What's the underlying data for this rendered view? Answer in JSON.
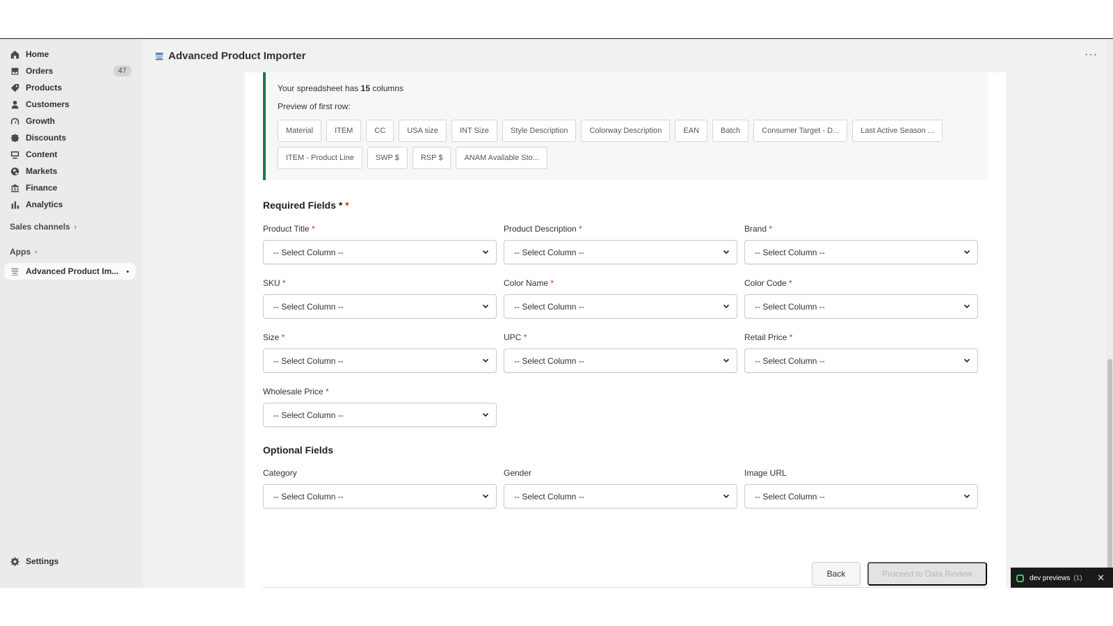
{
  "app": {
    "title": "Advanced Product Importer",
    "more": "···"
  },
  "sidebar": {
    "items": [
      {
        "label": "Home",
        "icon": "home-icon"
      },
      {
        "label": "Orders",
        "icon": "inbox-icon",
        "badge": "47"
      },
      {
        "label": "Products",
        "icon": "tag-icon"
      },
      {
        "label": "Customers",
        "icon": "person-icon"
      },
      {
        "label": "Growth",
        "icon": "gauge-icon"
      },
      {
        "label": "Discounts",
        "icon": "discount-icon"
      },
      {
        "label": "Content",
        "icon": "content-icon"
      },
      {
        "label": "Markets",
        "icon": "globe-icon"
      },
      {
        "label": "Finance",
        "icon": "bank-icon"
      },
      {
        "label": "Analytics",
        "icon": "bar-chart-icon"
      }
    ],
    "sales_channels": "Sales channels",
    "apps": "Apps",
    "active_app": "Advanced Product Im...",
    "settings": "Settings"
  },
  "info": {
    "prefix": "Your spreadsheet has ",
    "count": "15",
    "suffix": " columns",
    "preview_label": "Preview of first row:",
    "chips": [
      "Material",
      "ITEM",
      "CC",
      "USA size",
      "INT Size",
      "Style Description",
      "Colorway Description",
      "EAN",
      "Batch",
      "Consumer Target - D...",
      "Last Active Season ...",
      "ITEM - Product Line",
      "SWP $",
      "RSP $",
      "ANAM Available Sto..."
    ]
  },
  "required": {
    "title": "Required Fields * ",
    "title_star": "*",
    "fields": [
      {
        "label": "Product Title",
        "value": "-- Select Column --"
      },
      {
        "label": "Product Description",
        "value": "-- Select Column --"
      },
      {
        "label": "Brand",
        "value": "-- Select Column --"
      },
      {
        "label": "SKU",
        "value": "-- Select Column --"
      },
      {
        "label": "Color Name",
        "value": "-- Select Column --"
      },
      {
        "label": "Color Code",
        "value": "-- Select Column --"
      },
      {
        "label": "Size",
        "value": "-- Select Column --"
      },
      {
        "label": "UPC",
        "value": "-- Select Column --"
      },
      {
        "label": "Retail Price",
        "value": "-- Select Column --"
      },
      {
        "label": "Wholesale Price",
        "value": "-- Select Column --"
      }
    ]
  },
  "optional": {
    "title": "Optional Fields",
    "fields": [
      {
        "label": "Category",
        "value": "-- Select Column --"
      },
      {
        "label": "Gender",
        "value": "-- Select Column --"
      },
      {
        "label": "Image URL",
        "value": "-- Select Column --"
      }
    ]
  },
  "actions": {
    "back": "Back",
    "proceed": "Proceed to Data Review"
  },
  "dev_bar": {
    "label": "dev previews",
    "count": "(1)",
    "close": "✕"
  },
  "colors": {
    "accent": "#1b7a4a",
    "required": "#d72c0d",
    "sidebar_bg": "#ebebeb"
  }
}
